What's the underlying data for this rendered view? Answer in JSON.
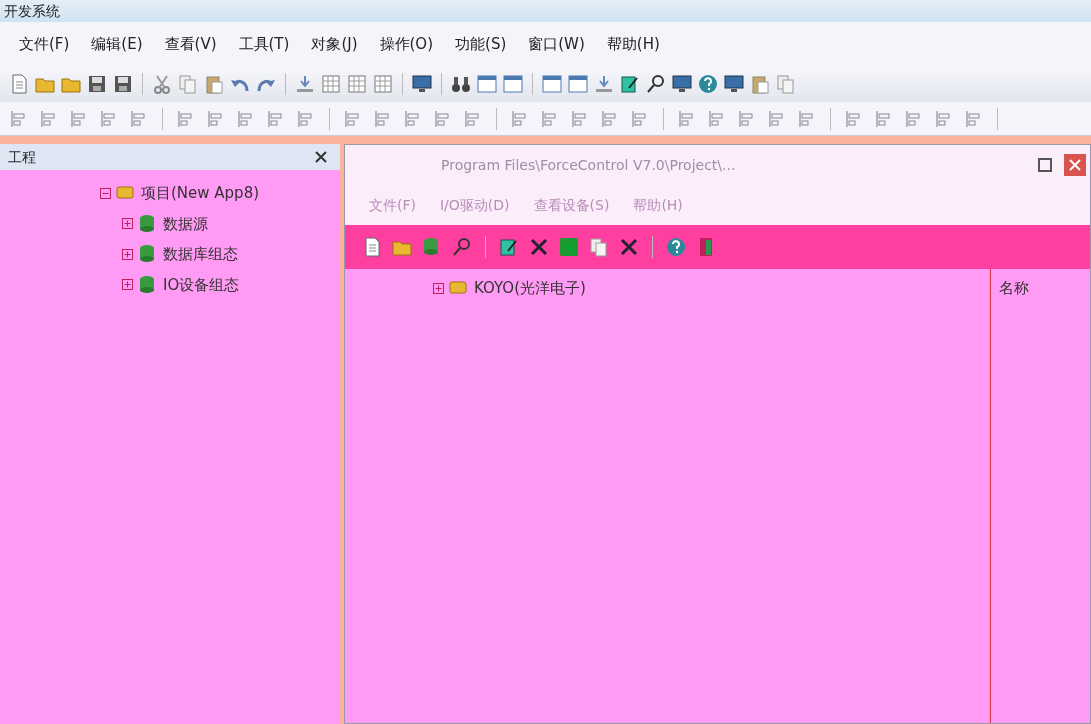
{
  "window": {
    "title": "开发系统"
  },
  "menu": [
    "文件(F)",
    "编辑(E)",
    "查看(V)",
    "工具(T)",
    "对象(J)",
    "操作(O)",
    "功能(S)",
    "窗口(W)",
    "帮助(H)"
  ],
  "project_panel": {
    "title": "工程",
    "tree": [
      {
        "label": "项目(New App8)",
        "expanded": true,
        "children": [
          {
            "label": "数据源",
            "expanded": false
          },
          {
            "label": "数据库组态",
            "expanded": false
          },
          {
            "label": "IO设备组态",
            "expanded": false
          }
        ]
      }
    ]
  },
  "io_window": {
    "title": "Program Files\\ForceControl V7.0\\Project\\...",
    "menu": [
      "文件(F)",
      "I/O驱动(D)",
      "查看设备(S)",
      "帮助(H)"
    ],
    "tree": [
      {
        "label": "KOYO(光洋电子)",
        "expanded": false
      }
    ],
    "columns": [
      "名称"
    ]
  }
}
